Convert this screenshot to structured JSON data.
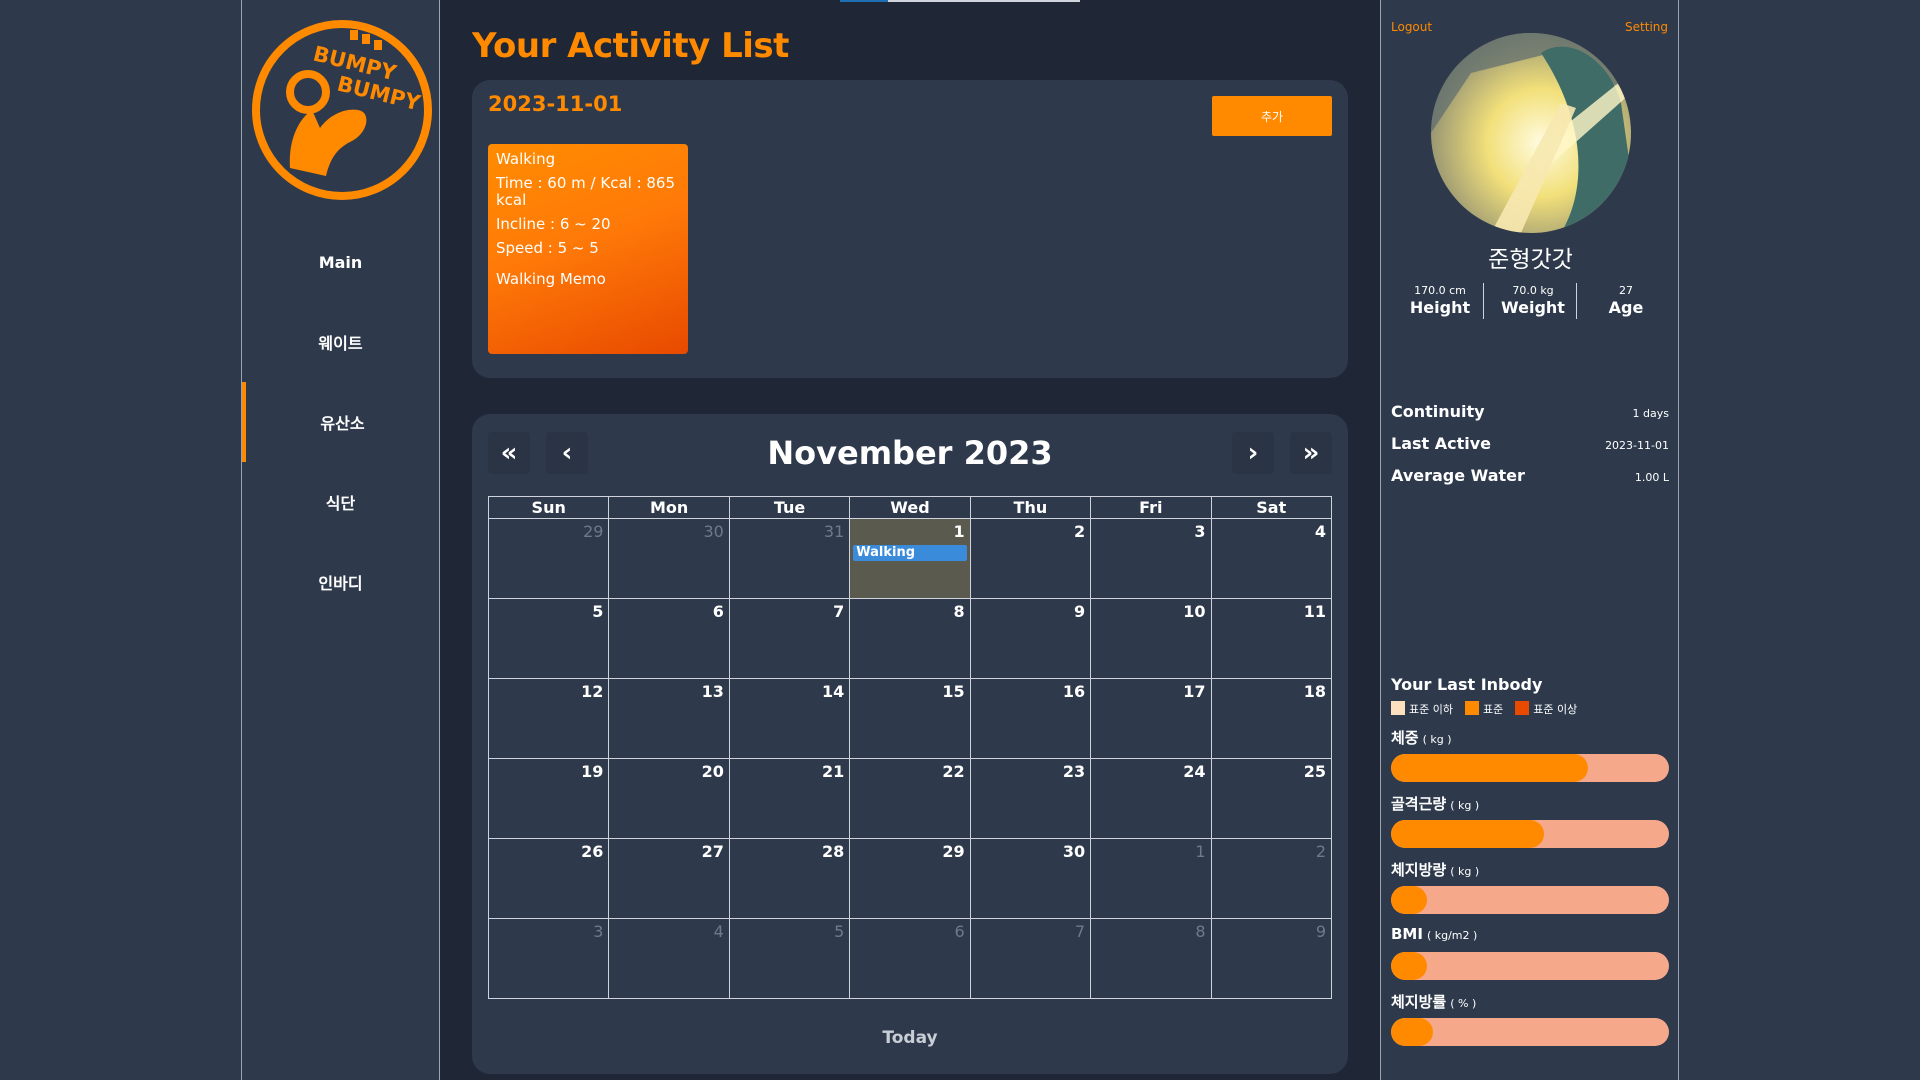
{
  "sidebar": {
    "logo_text_top": "BUMPY",
    "logo_text_bottom": "BUMPY",
    "items": [
      {
        "label": "Main"
      },
      {
        "label": "웨이트"
      },
      {
        "label": "유산소",
        "active": true
      },
      {
        "label": "식단"
      },
      {
        "label": "인바디"
      }
    ]
  },
  "main": {
    "title": "Your Activity List",
    "selected_date": "2023-11-01",
    "add_button": "추가",
    "activity": {
      "name": "Walking",
      "time_kcal": "Time : 60 m / Kcal : 865 kcal",
      "incline": "Incline : 6 ~ 20",
      "speed": "Speed : 5 ~ 5",
      "memo": "Walking Memo"
    }
  },
  "calendar": {
    "title": "November 2023",
    "nav": {
      "prev_year": "«",
      "prev_month": "‹",
      "next_month": "›",
      "next_year": "»"
    },
    "weekdays": [
      "Sun",
      "Mon",
      "Tue",
      "Wed",
      "Thu",
      "Fri",
      "Sat"
    ],
    "weeks": [
      [
        {
          "d": "29",
          "o": true
        },
        {
          "d": "30",
          "o": true
        },
        {
          "d": "31",
          "o": true
        },
        {
          "d": "1",
          "today": true,
          "event": "Walking"
        },
        {
          "d": "2"
        },
        {
          "d": "3"
        },
        {
          "d": "4"
        }
      ],
      [
        {
          "d": "5"
        },
        {
          "d": "6"
        },
        {
          "d": "7"
        },
        {
          "d": "8"
        },
        {
          "d": "9"
        },
        {
          "d": "10"
        },
        {
          "d": "11"
        }
      ],
      [
        {
          "d": "12"
        },
        {
          "d": "13"
        },
        {
          "d": "14"
        },
        {
          "d": "15"
        },
        {
          "d": "16"
        },
        {
          "d": "17"
        },
        {
          "d": "18"
        }
      ],
      [
        {
          "d": "19"
        },
        {
          "d": "20"
        },
        {
          "d": "21"
        },
        {
          "d": "22"
        },
        {
          "d": "23"
        },
        {
          "d": "24"
        },
        {
          "d": "25"
        }
      ],
      [
        {
          "d": "26"
        },
        {
          "d": "27"
        },
        {
          "d": "28"
        },
        {
          "d": "29"
        },
        {
          "d": "30"
        },
        {
          "d": "1",
          "o": true
        },
        {
          "d": "2",
          "o": true
        }
      ],
      [
        {
          "d": "3",
          "o": true
        },
        {
          "d": "4",
          "o": true
        },
        {
          "d": "5",
          "o": true
        },
        {
          "d": "6",
          "o": true
        },
        {
          "d": "7",
          "o": true
        },
        {
          "d": "8",
          "o": true
        },
        {
          "d": "9",
          "o": true
        }
      ]
    ],
    "today_button": "Today"
  },
  "profile": {
    "logout": "Logout",
    "setting": "Setting",
    "username": "준형갓갓",
    "stats": [
      {
        "value": "170.0 cm",
        "label": "Height"
      },
      {
        "value": "70.0 kg",
        "label": "Weight"
      },
      {
        "value": "27",
        "label": "Age"
      }
    ],
    "info": [
      {
        "key": "Continuity",
        "value": "1 days"
      },
      {
        "key": "Last Active",
        "value": "2023-11-01"
      },
      {
        "key": "Average Water",
        "value": "1.00 L"
      }
    ],
    "inbody_title": "Your Last Inbody",
    "legend": [
      {
        "label": "표준 이하",
        "color": "#fde0bd"
      },
      {
        "label": "표준",
        "color": "#ff8a00"
      },
      {
        "label": "표준 이상",
        "color": "#e84a00"
      }
    ],
    "metrics": [
      {
        "label": "체중",
        "unit": "( kg )",
        "fraction": 0.71
      },
      {
        "label": "골격근량",
        "unit": "( kg )",
        "fraction": 0.55
      },
      {
        "label": "체지방량",
        "unit": "( kg )",
        "fraction": 0.13
      },
      {
        "label": "BMI",
        "unit": "( kg/m2 )",
        "fraction": 0.13
      },
      {
        "label": "체지방률",
        "unit": "( % )",
        "fraction": 0.15
      }
    ]
  },
  "colors": {
    "accent": "#ff8a00",
    "bar_track": "#f6a98a",
    "event": "#3b8bdb"
  }
}
